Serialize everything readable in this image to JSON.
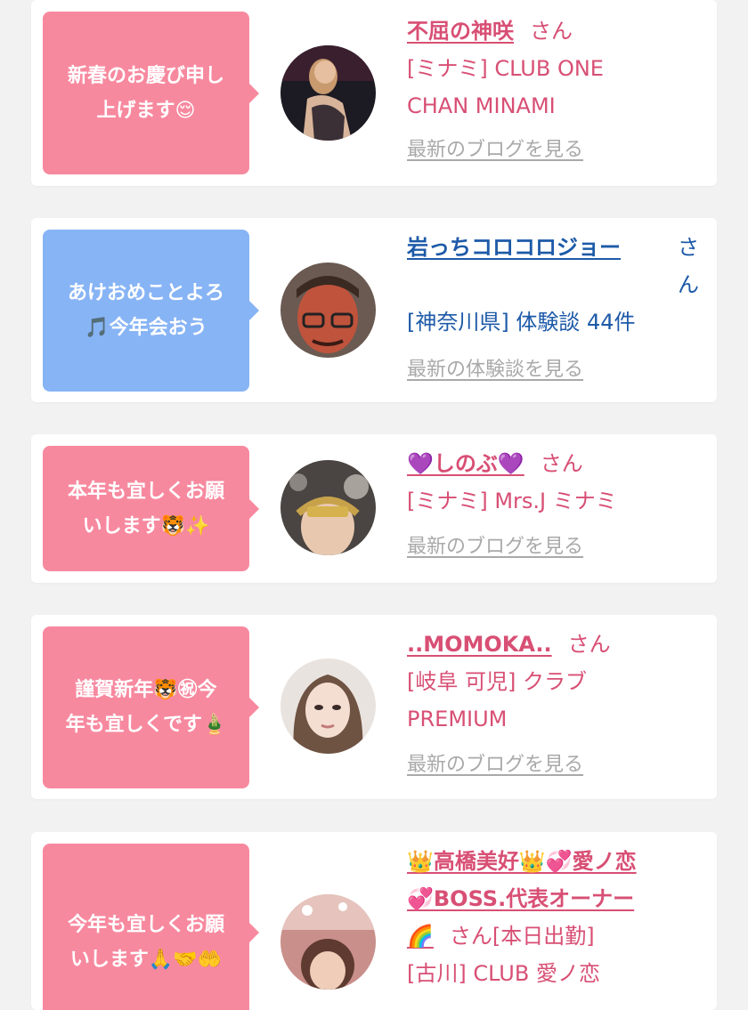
{
  "colors": {
    "bubble_pink": "#f7899f",
    "bubble_blue": "#87b4f5",
    "text_pink": "#d84f74",
    "text_blue": "#1d5aa8",
    "link_gray": "#a9a9a9"
  },
  "cards": [
    {
      "message": "新春のお慶び申し\n上げます😌",
      "name": "不屈の神咲",
      "honorific": "さん",
      "detail": "[ミナミ] CLUB ONE\nCHAN MINAMI",
      "link": "最新のブログを見る"
    },
    {
      "message": "あけおめことよろ\n🎵今年会おう",
      "name": "岩っちコロコロジョー",
      "honorific": "さ\nん",
      "detail": "[神奈川県] 体験談 44件",
      "link": "最新の体験談を見る"
    },
    {
      "message": "本年も宜しくお願\nいします🐯✨",
      "name": "💜しのぶ💜",
      "honorific": "さん",
      "detail": "[ミナミ] Mrs.J ミナミ",
      "link": "最新のブログを見る"
    },
    {
      "message": "謹賀新年🐯㊗今\n年も宜しくです🎍",
      "name": "..MOMOKA..",
      "honorific": "さん",
      "detail": "[岐阜 可児] クラブ\nPREMIUM",
      "link": "最新のブログを見る"
    },
    {
      "message": "今年も宜しくお願\nいします🙏🤝🤲",
      "name_line1": "👑高橋美好👑💞愛ノ恋",
      "name_line2": "💞BOSS.代表オーナー",
      "name_line3": "🌈",
      "honorific": "さん[本日出勤]",
      "detail": "[古川] CLUB 愛ノ恋"
    }
  ]
}
